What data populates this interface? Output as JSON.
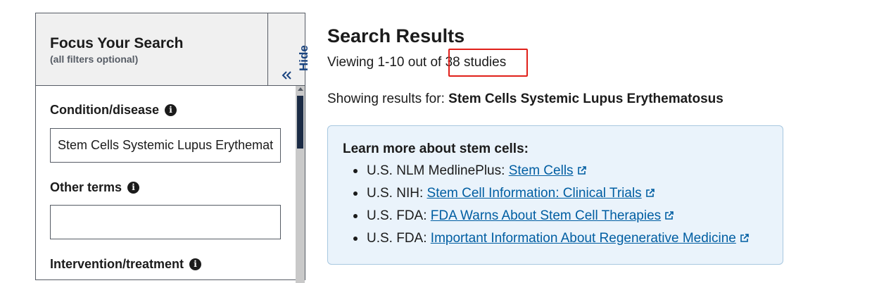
{
  "sidebar": {
    "title": "Focus Your Search",
    "subtitle": "(all filters optional)",
    "hide_label": "Hide",
    "fields": [
      {
        "label": "Condition/disease",
        "value": "Stem Cells Systemic Lupus Erythematosus",
        "info_icon": "info-icon"
      },
      {
        "label": "Other terms",
        "value": "",
        "info_icon": "info-icon"
      },
      {
        "label": "Intervention/treatment",
        "info_icon": "info-icon"
      }
    ]
  },
  "main": {
    "title": "Search Results",
    "viewing_prefix": "Viewing 1-10 out of ",
    "viewing_count": "38 studies",
    "showing_prefix": "Showing results for: ",
    "showing_query": "Stem Cells Systemic Lupus Erythematosus",
    "learn_more": {
      "title": "Learn more about stem cells:",
      "items": [
        {
          "prefix": "U.S. NLM MedlinePlus: ",
          "link": "Stem Cells"
        },
        {
          "prefix": "U.S. NIH: ",
          "link": "Stem Cell Information: Clinical Trials"
        },
        {
          "prefix": "U.S. FDA: ",
          "link": "FDA Warns About Stem Cell Therapies"
        },
        {
          "prefix": "U.S. FDA: ",
          "link": "Important Information About Regenerative Medicine"
        }
      ]
    }
  },
  "colors": {
    "link": "#005ea2",
    "highlight": "#e0201a",
    "info_box_bg": "#eaf3fb",
    "header_bg": "#f0f0f0",
    "hide_text": "#1a4480"
  }
}
